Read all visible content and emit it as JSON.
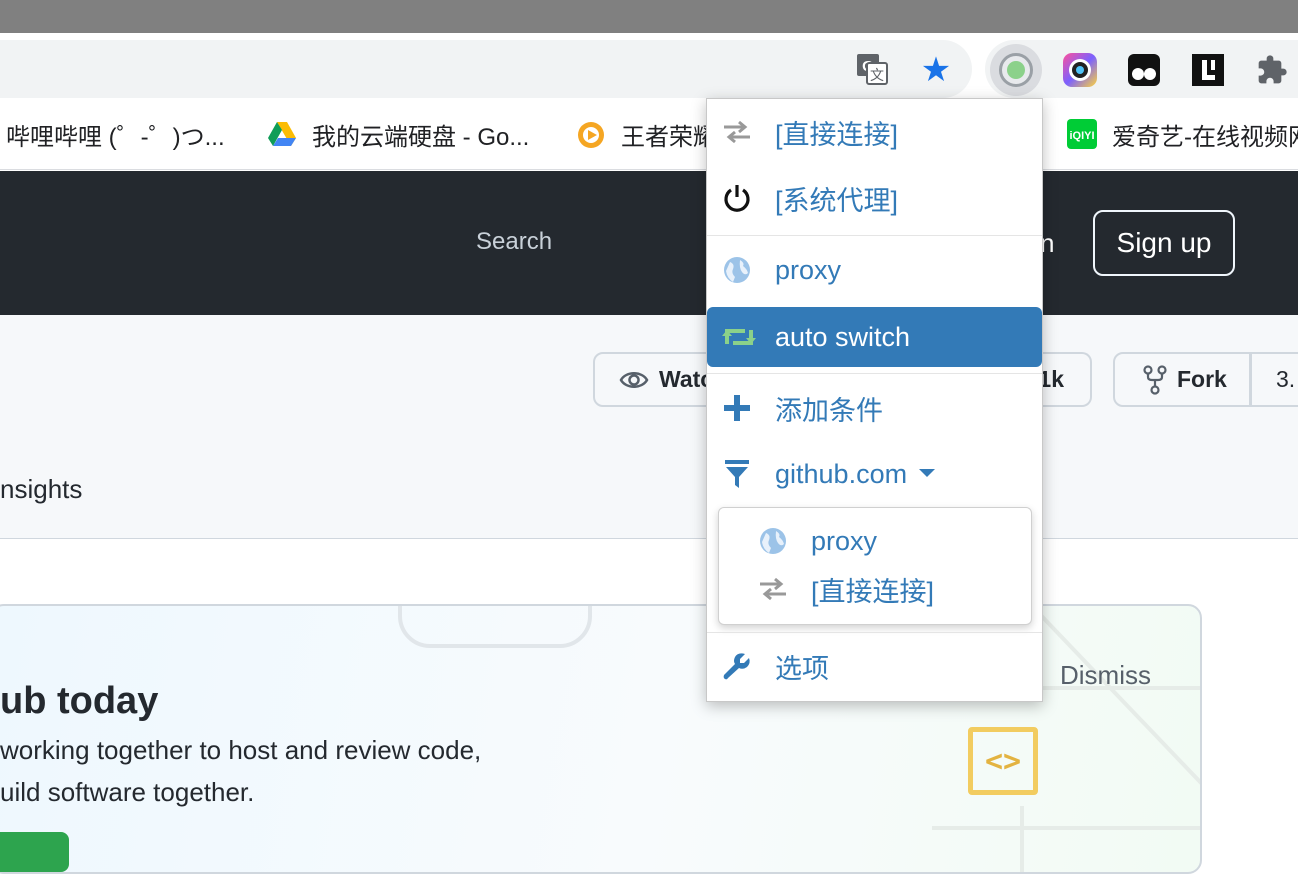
{
  "browser": {
    "bookmarks": [
      {
        "label": "哔哩哔哩 (゜-゜)つ...",
        "icon": "bilibili-icon"
      },
      {
        "label": "我的云端硬盘 - Go...",
        "icon": "google-drive-icon"
      },
      {
        "label": "王者荣耀",
        "icon": "game-icon"
      },
      {
        "label": "爱奇艺-在线视频网",
        "icon": "iqiyi-icon"
      }
    ],
    "extensions": [
      "translate-icon",
      "star-icon",
      "proxy-switch-icon",
      "colorful-camera-icon",
      "tampermonkey-icon",
      "letter-l-icon",
      "puzzle-icon"
    ]
  },
  "page": {
    "search_label": "Search",
    "signin_tail": "n",
    "signup_label": "Sign up",
    "watch_label": "Watc",
    "watch_count": "1k",
    "fork_label": "Fork",
    "fork_count": "3.",
    "insights_label": "nsights",
    "card": {
      "heading": "ub today",
      "line1": "working together to host and review code,",
      "line2": "uild software together.",
      "dismiss": "Dismiss",
      "code_glyph": "<>"
    }
  },
  "popup": {
    "items": [
      {
        "label": "[直接连接]",
        "icon": "direct-arrows-icon"
      },
      {
        "label": "[系统代理]",
        "icon": "power-icon"
      },
      {
        "label": "proxy",
        "icon": "globe-icon"
      },
      {
        "label": "auto switch",
        "icon": "retweet-icon",
        "active": true
      },
      {
        "label": "添加条件",
        "icon": "plus-icon"
      },
      {
        "label": "github.com",
        "icon": "filter-icon"
      },
      {
        "label": "选项",
        "icon": "wrench-icon"
      }
    ],
    "submenu": [
      {
        "label": "proxy",
        "icon": "globe-icon"
      },
      {
        "label": "[直接连接]",
        "icon": "direct-arrows-icon"
      }
    ]
  },
  "colors": {
    "accent": "#337ab7",
    "github_header": "#24292f",
    "omega_green": "#8bd18a"
  }
}
